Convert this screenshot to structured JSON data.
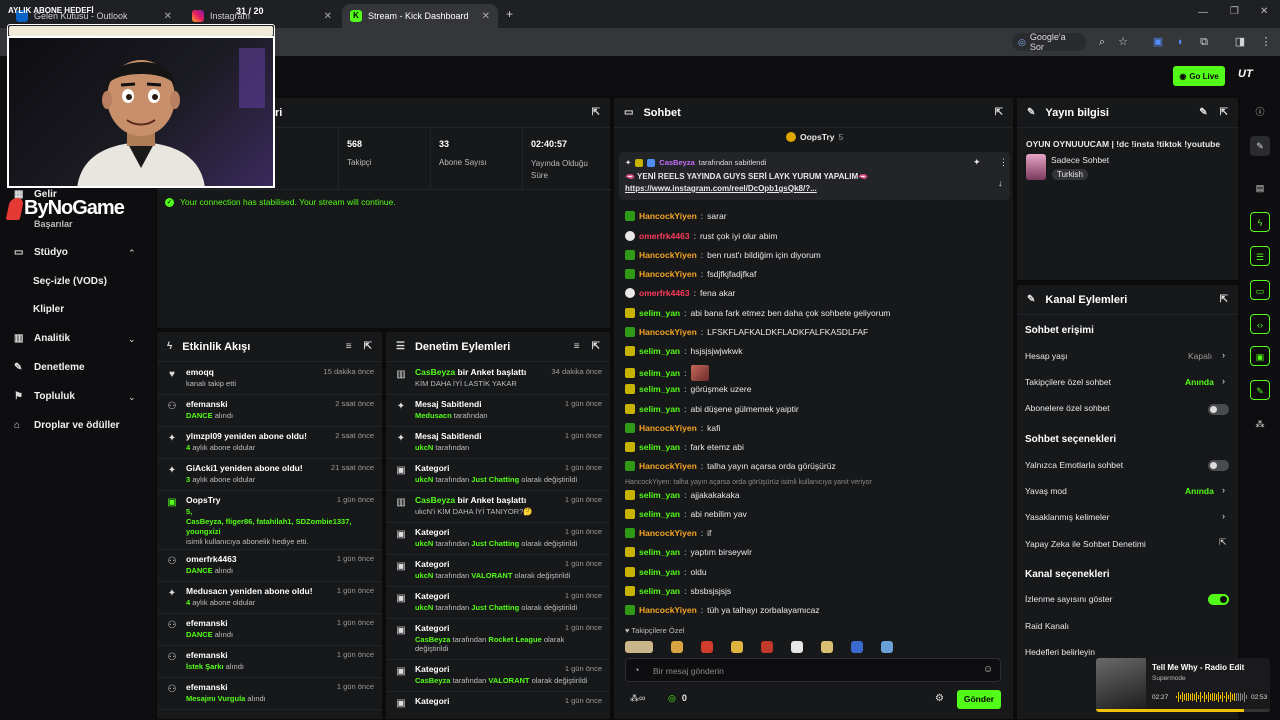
{
  "browser": {
    "tabs": [
      {
        "label": "Gelen Kutusu - Outlook",
        "icon": "outlook-icon"
      },
      {
        "label": "Instagram",
        "icon": "instagram-icon"
      },
      {
        "label": "Stream - Kick Dashboard",
        "icon": "kick-icon"
      }
    ],
    "google_lens": "Google'a Sor"
  },
  "overlay": {
    "goal_label": "AYLIK ABONE HEDEFİ",
    "goal_count": "31 / 20",
    "goal_fraction": 1.0,
    "brand": "ByNoGame"
  },
  "kick": {
    "go_live": "Go Live"
  },
  "sidebar": {
    "gelir": "Gelir",
    "basarilar": "Başarılar",
    "studyo": "Stüdyo",
    "vods": "Seç-izle (VODs)",
    "klipler": "Klipler",
    "analitik": "Analitik",
    "denetleme": "Denetleme",
    "topluluk": "Topluluk",
    "droplar": "Droplar ve ödüller"
  },
  "stats": {
    "title_fragment": "ri",
    "first_label_fragment": "ci",
    "items": [
      {
        "value": "568",
        "label": "Takipçi"
      },
      {
        "value": "33",
        "label": "Abone Sayısı"
      },
      {
        "value": "02:40:57",
        "label": "Yayında Olduğu Süre"
      }
    ],
    "notice": "Your connection has stabilised. Your stream will continue."
  },
  "activity": {
    "title": "Etkinlik Akışı",
    "events": [
      {
        "t1": "emoqq",
        "t2": "kanalı takip etti",
        "time": "15 dakika önce"
      },
      {
        "t1": "efemanski",
        "g": "DANCE",
        "t2": " alındı",
        "time": "2 saat önce"
      },
      {
        "t1": "ylmzpl09 yeniden abone oldu!",
        "g": "4",
        "t2": " aylık abone oldular",
        "time": "2 saat önce"
      },
      {
        "t1": "GiAcki1 yeniden abone oldu!",
        "g": "3",
        "t2": " aylık abone oldular",
        "time": "21 saat önce"
      },
      {
        "t1": "OopsTry",
        "g": "5,",
        "g2": "CasBeyza, fliger86, fatahilah1, SDZombie1337,",
        "g3": "youngxizi",
        "t2": "isimli kullanıcıya abonelik hediye etti.",
        "time": "1 gün önce"
      },
      {
        "t1": "omerfrk4463",
        "g": "DANCE",
        "t2": " alındı",
        "time": "1 gün önce"
      },
      {
        "t1": "Medusacn yeniden abone oldu!",
        "g": "4",
        "t2": " aylık abone oldular",
        "time": "1 gün önce"
      },
      {
        "t1": "efemanski",
        "g": "DANCE",
        "t2": " alındı",
        "time": "1 gün önce"
      },
      {
        "t1": "efemanski",
        "g": "İstek Şarkı",
        "t2": " alındı",
        "time": "1 gün önce"
      },
      {
        "t1": "efemanski",
        "g": "Mesajını Vurgula",
        "t2": " alındı",
        "time": "1 gün önce"
      }
    ]
  },
  "moderation": {
    "title": "Denetim Eylemleri",
    "events": [
      {
        "user": "CasBeyza",
        "t1": " bir Anket başlattı",
        "t2": "KİM DAHA İYİ LASTİK YAKAR",
        "time": "34 dakika önce"
      },
      {
        "t1": "Mesaj Sabitlendi",
        "g": "Medusacn",
        "t2": " tarafından",
        "time": "1 gün önce"
      },
      {
        "t1": "Mesaj Sabitlendi",
        "g": "ukcN",
        "t2": " tarafından",
        "time": "1 gün önce"
      },
      {
        "t1": "Kategori",
        "g": "ukcN",
        "t2": " tarafından ",
        "g2": "Just Chatting",
        "t3": " olarak değiştirildi",
        "time": "1 gün önce"
      },
      {
        "user": "CasBeyza",
        "t1": " bir Anket başlattı",
        "t2": "ukcN'i KİM DAHA İYİ TANIYOR?🤔",
        "time": "1 gün önce"
      },
      {
        "t1": "Kategori",
        "g": "ukcN",
        "t2": " tarafından ",
        "g2": "Just Chatting",
        "t3": " olarak değiştirildi",
        "time": "1 gün önce"
      },
      {
        "t1": "Kategori",
        "g": "ukcN",
        "t2": " tarafından ",
        "g2": "VALORANT",
        "t3": " olarak değiştirildi",
        "time": "1 gün önce"
      },
      {
        "t1": "Kategori",
        "g": "ukcN",
        "t2": " tarafından ",
        "g2": "Just Chatting",
        "t3": " olarak değiştirildi",
        "time": "1 gün önce"
      },
      {
        "t1": "Kategori",
        "g": "CasBeyza",
        "t2": " tarafından ",
        "g2": "Rocket League",
        "t3": " olarak değiştirildi",
        "time": "1 gün önce"
      },
      {
        "t1": "Kategori",
        "g": "CasBeyza",
        "t2": " tarafından ",
        "g2": "VALORANT",
        "t3": " olarak değiştirildi",
        "time": "1 gün önce"
      },
      {
        "t1": "Kategori",
        "time": "1 gün önce"
      }
    ]
  },
  "chat": {
    "title": "Sohbet",
    "top_gifter": "OopsTry",
    "top_gifter_count": "5",
    "pinned_by": "CasBeyza",
    "pinned_label": "tarafından sabitlendi",
    "pinned_text": "🫦 YENİ REELS YAYINDA GUYS SERİ LAYK YURUM YAPALIM🫦",
    "pinned_link": "https://www.instagram.com/reel/DcOpb1gsQk8/?...",
    "reply_note": "HancockYiyen: talha yayın açarsa orda görüşürüz isimli kullanıcıya yanıt veriyor",
    "messages": [
      {
        "user": "HancockYiyen",
        "color": "#f5a623",
        "badge": "g",
        "text": "sarar"
      },
      {
        "user": "omerfrk4463",
        "color": "#ff3b5c",
        "badge": "w",
        "text": "rust çok iyi olur abim"
      },
      {
        "user": "HancockYiyen",
        "color": "#f5a623",
        "badge": "g",
        "text": "ben rust'ı bildiğim için diyorum"
      },
      {
        "user": "HancockYiyen",
        "color": "#f5a623",
        "badge": "g",
        "text": "fsdjfkjfadjfkaf"
      },
      {
        "user": "omerfrk4463",
        "color": "#ff3b5c",
        "badge": "w",
        "text": "fena akar"
      },
      {
        "user": "selim_yan",
        "color": "#53fc18",
        "badge": "y",
        "text": "abi bana fark etmez ben daha çok sohbete geliyorum"
      },
      {
        "user": "HancockYiyen",
        "color": "#f5a623",
        "badge": "g",
        "text": "LFSKFLAFKALDKFLADKFALFKASDLFAF"
      },
      {
        "user": "selim_yan",
        "color": "#53fc18",
        "badge": "y",
        "text": "hsjsjsjwjwkwk"
      },
      {
        "user": "selim_yan",
        "color": "#53fc18",
        "badge": "y",
        "text": ""
      },
      {
        "user": "selim_yan",
        "color": "#53fc18",
        "badge": "y",
        "text": "görüşmek uzere"
      },
      {
        "user": "selim_yan",
        "color": "#53fc18",
        "badge": "y",
        "text": "abi düşene gülmemek yaiptir"
      },
      {
        "user": "HancockYiyen",
        "color": "#f5a623",
        "badge": "g",
        "text": "kafi"
      },
      {
        "user": "selim_yan",
        "color": "#53fc18",
        "badge": "y",
        "text": "fark etemz abi"
      },
      {
        "user": "HancockYiyen",
        "color": "#f5a623",
        "badge": "g",
        "text": "talha yayın açarsa orda görüşürüz"
      },
      {
        "user": "selim_yan",
        "color": "#53fc18",
        "badge": "y",
        "text": "ajjakakakaka"
      },
      {
        "user": "selim_yan",
        "color": "#53fc18",
        "badge": "y",
        "text": "abi nebilim yav"
      },
      {
        "user": "HancockYiyen",
        "color": "#f5a623",
        "badge": "g",
        "text": "if"
      },
      {
        "user": "selim_yan",
        "color": "#53fc18",
        "badge": "y",
        "text": "yaptım birseywlr"
      },
      {
        "user": "selim_yan",
        "color": "#53fc18",
        "badge": "y",
        "text": "oldu"
      },
      {
        "user": "selim_yan",
        "color": "#53fc18",
        "badge": "y",
        "text": "sbsbsjsjsjs"
      },
      {
        "user": "HancockYiyen",
        "color": "#f5a623",
        "badge": "g",
        "text": "tüh ya talhayı zorbalayamıcaz"
      }
    ],
    "followers_only": "Takipçilere Özel",
    "input_placeholder": "Bir mesaj gönderin",
    "points": "0",
    "send": "Gönder"
  },
  "stream_info": {
    "title": "Yayın bilgisi",
    "stream_title": "OYUN OYNUUUCAM | !dc !insta !tiktok !youtube",
    "category": "Sadece Sohbet",
    "tag": "Turkish"
  },
  "channel_actions": {
    "title": "Kanal Eylemleri",
    "chat_access": "Sohbet erişimi",
    "account_age": "Hesap yaşı",
    "account_age_val": "Kapalı",
    "followers_chat": "Takipçilere özel sohbet",
    "followers_chat_val": "Anında",
    "subs_chat": "Abonelere özel sohbet",
    "chat_options": "Sohbet seçenekleri",
    "emote_only": "Yalnızca Emotlarla sohbet",
    "slow_mode": "Yavaş mod",
    "slow_mode_val": "Anında",
    "banned_words": "Yasaklanmış kelimeler",
    "ai_mod": "Yapay Zeka ile Sohbet Denetimi",
    "channel_options": "Kanal seçenekleri",
    "show_viewers": "İzlenme sayısını göster",
    "raid": "Raid Kanalı",
    "goals": "Hedefleri belirleyin"
  },
  "music": {
    "title": "Tell Me Why - Radio Edit",
    "artist": "Supermode",
    "elapsed": "02:27",
    "total": "02:53",
    "progress": 0.85
  },
  "colors": {
    "accent": "#53fc18",
    "panel": "#17181a"
  }
}
